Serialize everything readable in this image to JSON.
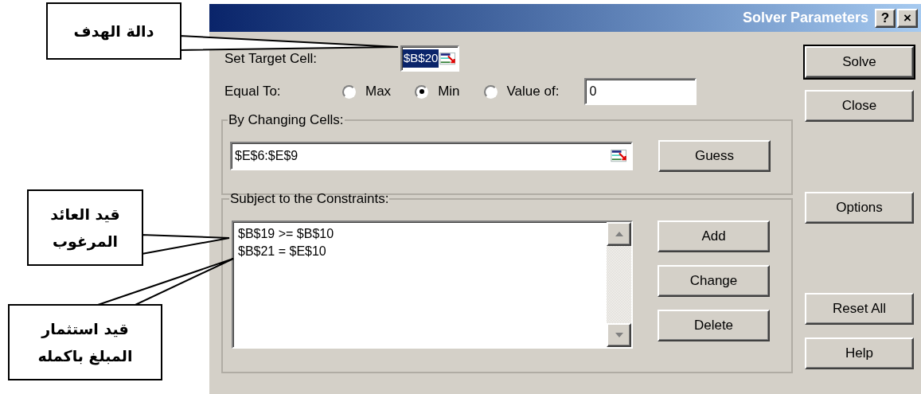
{
  "callouts": [
    {
      "text": "دالة الهدف"
    },
    {
      "text": "قيد العائد المرغوب"
    },
    {
      "text": "قيد استثمار المبلغ باكمله"
    }
  ],
  "window": {
    "title": "Solver Parameters",
    "help_button": "?",
    "close_button": "×"
  },
  "target": {
    "label": "Set Target Cell:",
    "value": "$B$20",
    "selected": true
  },
  "equal_to": {
    "label": "Equal To:",
    "value": "0",
    "options": [
      {
        "label": "Max",
        "selected": false
      },
      {
        "label": "Min",
        "selected": true
      },
      {
        "label": "Value of:",
        "selected": false
      }
    ]
  },
  "changing": {
    "label": "By Changing Cells:",
    "value": "$E$6:$E$9",
    "button": {
      "label": "Guess"
    }
  },
  "constraints": {
    "label": "Subject to the Constraints:",
    "items": [
      "$B$19 >= $B$10",
      "$B$21 = $E$10"
    ],
    "buttons": [
      {
        "label": "Add"
      },
      {
        "label": "Change"
      },
      {
        "label": "Delete"
      }
    ]
  },
  "side_buttons": [
    {
      "label": "Solve",
      "default": true
    },
    {
      "label": "Close",
      "default": false
    },
    {
      "label": "Options",
      "default": false
    },
    {
      "label": "Reset All",
      "default": false
    },
    {
      "label": "Help",
      "default": false
    }
  ]
}
